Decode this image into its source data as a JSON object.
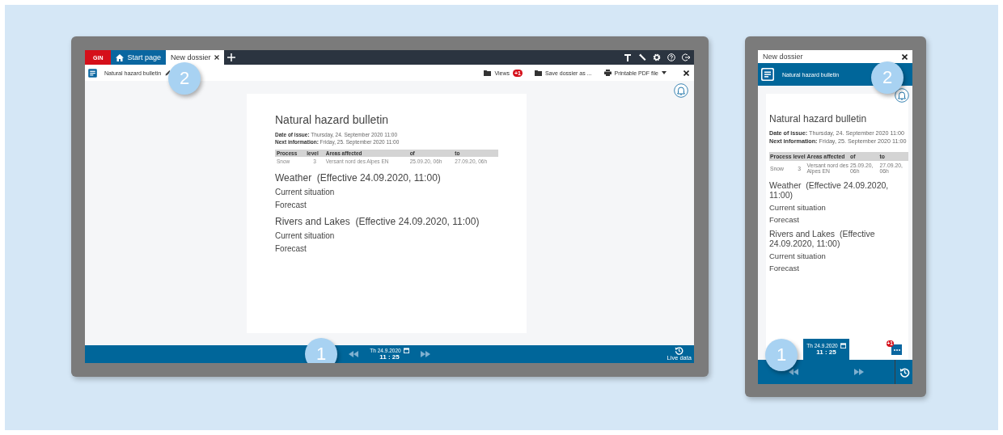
{
  "desktop": {
    "tabs": [
      {
        "label": "GIN",
        "kind": "brand",
        "selected": false
      },
      {
        "label": "Start page",
        "kind": "home",
        "selected": false
      },
      {
        "label": "New dossier",
        "kind": "document",
        "selected": true
      }
    ],
    "toolbar": {
      "document_title": "Natural hazard bulletin",
      "actions": [
        {
          "label": "Views",
          "kind": "badge",
          "badge": "+1"
        },
        {
          "label": "Save dossier as ...",
          "kind": "folder"
        },
        {
          "label": "Printable PDF file",
          "kind": "dropdown"
        }
      ]
    },
    "bulletin": {
      "title": "Natural hazard bulletin",
      "meta": [
        "**Date of issue:** Thursday, 24. September 2020 11:00",
        "**Next information:** Friday, 25. September 2020 11:00"
      ],
      "columns": [
        "Process",
        "level",
        "Areas affected",
        "of",
        "to"
      ],
      "rows": [
        [
          "Snow",
          "3",
          "Versant nord des Alpes EN",
          "25.09.20, 06h",
          "27.09.20, 06h"
        ]
      ],
      "sections": [
        {
          "heading": "Weather",
          "effective": "(Effective 24.09.2020, 11:00)",
          "items": [
            "Current situation",
            "Forecast"
          ]
        },
        {
          "heading": "Rivers and Lakes",
          "effective": "(Effective 24.09.2020, 11:00)",
          "items": [
            "Current situation",
            "Forecast"
          ]
        }
      ]
    },
    "timebar": {
      "date": "Th 24.9.2020",
      "time": "11 : 25",
      "live_label": "Live data"
    },
    "callouts": [
      "2",
      "1"
    ]
  },
  "mobile": {
    "title": "New dossier",
    "document_title": "Natural hazard bulletin",
    "bulletin": {
      "title": "Natural hazard bulletin",
      "meta": [
        "**Date of issue:** Thursday, 24. September 2020 11:00",
        "**Next information:** Friday, 25. September 2020 11:00"
      ],
      "columns": [
        "Process",
        "level",
        "Areas affected",
        "of",
        "to"
      ],
      "rows": [
        [
          "Snow",
          "3",
          "Versant nord des Alpes EN",
          "25.09.20, 06h",
          "27.09.20, 06h"
        ]
      ],
      "sections": [
        {
          "heading": "Weather",
          "effective": "(Effective 24.09.2020, 11:00)",
          "items": [
            "Current situation",
            "Forecast"
          ]
        },
        {
          "heading": "Rivers and Lakes",
          "effective": "(Effective 24.09.2020, 11:00)",
          "items": [
            "Current situation",
            "Forecast"
          ]
        }
      ]
    },
    "timebar": {
      "date": "Th 24.9.2020",
      "time": "11 : 25"
    },
    "chat_badge": "+1",
    "callouts": [
      "2",
      "1"
    ]
  }
}
